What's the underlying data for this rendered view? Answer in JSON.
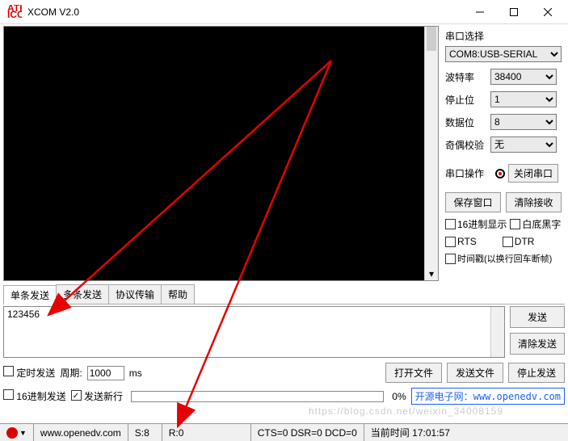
{
  "title": "XCOM V2.0",
  "sidepanel": {
    "port_label": "串口选择",
    "port_value": "COM8:USB-SERIAL",
    "baud_label": "波特率",
    "baud_value": "38400",
    "stop_label": "停止位",
    "stop_value": "1",
    "data_label": "数据位",
    "data_value": "8",
    "parity_label": "奇偶校验",
    "parity_value": "无",
    "op_label": "串口操作",
    "op_button": "关闭串口",
    "save_btn": "保存窗口",
    "clear_btn": "清除接收",
    "hex_disp": "16进制显示",
    "white_bg": "白底黑字",
    "rts": "RTS",
    "dtr": "DTR",
    "timestamp": "时间戳(以换行回车断帧)"
  },
  "tabs": {
    "single": "单条发送",
    "multi": "多条发送",
    "proto": "协议传输",
    "help": "帮助"
  },
  "send": {
    "input_value": "123456",
    "send_btn": "发送",
    "clear_btn": "清除发送"
  },
  "opts": {
    "timed_send": "定时发送",
    "period_label": "周期:",
    "period_value": "1000",
    "period_unit": "ms",
    "open_file": "打开文件",
    "send_file": "发送文件",
    "stop_send": "停止发送",
    "hex_send": "16进制发送",
    "send_newline": "发送新行",
    "progress_pct": "0%",
    "link_prefix": "开源电子网：",
    "link_url": "www.openedv.com"
  },
  "status": {
    "url": "www.openedv.com",
    "s": "S:8",
    "r": "R:0",
    "signals": "CTS=0 DSR=0 DCD=0",
    "time_label": "当前时间",
    "time_value": "17:01:57"
  },
  "watermark": "https://blog.csdn.net/weixin_34008159"
}
